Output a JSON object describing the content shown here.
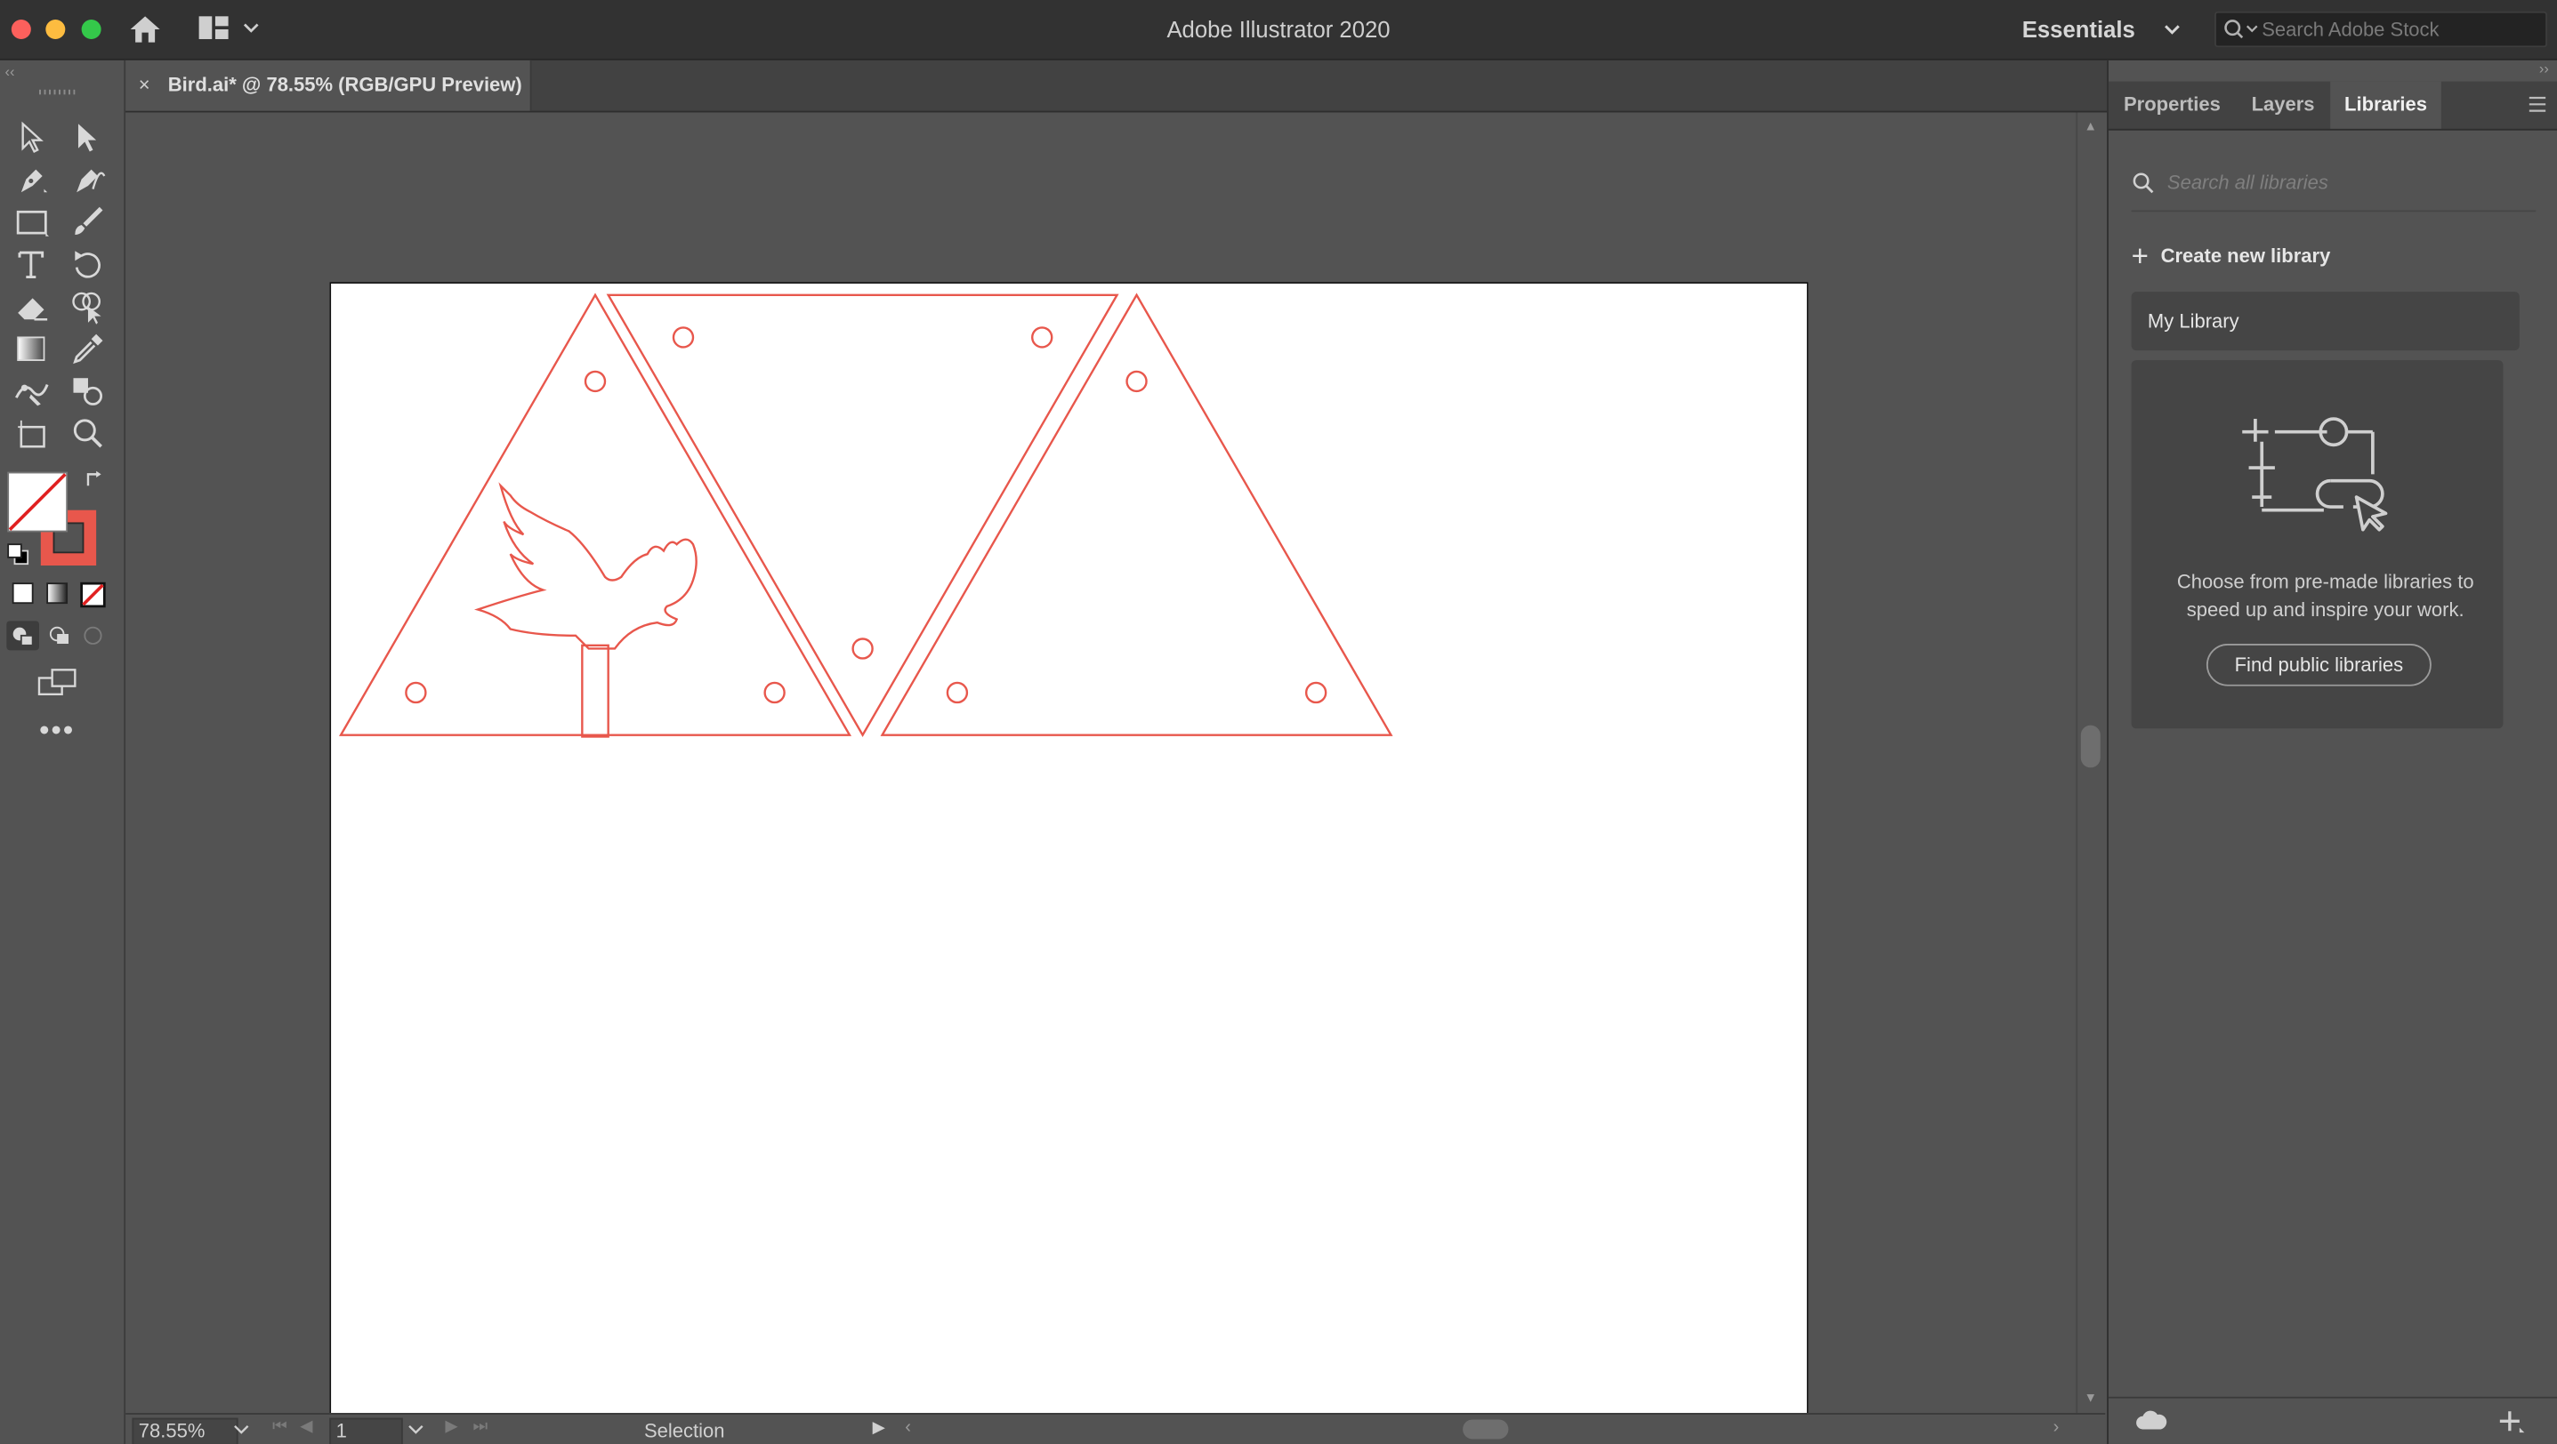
{
  "window": {
    "title": "Adobe Illustrator 2020"
  },
  "topbar": {
    "workspace": "Essentials",
    "stock_search_placeholder": "Search Adobe Stock"
  },
  "document": {
    "tab_title": "Bird.ai* @ 78.55% (RGB/GPU Preview)",
    "close_glyph": "×"
  },
  "toolbar": {
    "tools": [
      "selection-tool",
      "direct-selection-tool",
      "pen-tool",
      "curvature-tool",
      "rectangle-tool",
      "paintbrush-tool",
      "type-tool",
      "rotate-tool",
      "eraser-tool",
      "shape-builder-tool",
      "gradient-tool",
      "eyedropper-tool",
      "puppet-warp-tool",
      "live-paint-tool",
      "artboard-tool",
      "zoom-tool"
    ],
    "fill_color": "#ffffff",
    "stroke_color": "#e8574c"
  },
  "statusbar": {
    "zoom": "78.55%",
    "page": "1",
    "status": "Selection"
  },
  "panel": {
    "tabs": [
      {
        "label": "Properties",
        "active": false
      },
      {
        "label": "Layers",
        "active": false
      },
      {
        "label": "Libraries",
        "active": true
      }
    ],
    "search_placeholder": "Search all libraries",
    "create_label": "Create new library",
    "library_name": "My Library",
    "empty_desc": "Choose from pre-made libraries to speed up and inspire your work.",
    "find_button": "Find public libraries"
  },
  "colors": {
    "accent_stroke": "#e8574c",
    "chrome_dark": "#323232",
    "panel_bg": "#535353"
  }
}
